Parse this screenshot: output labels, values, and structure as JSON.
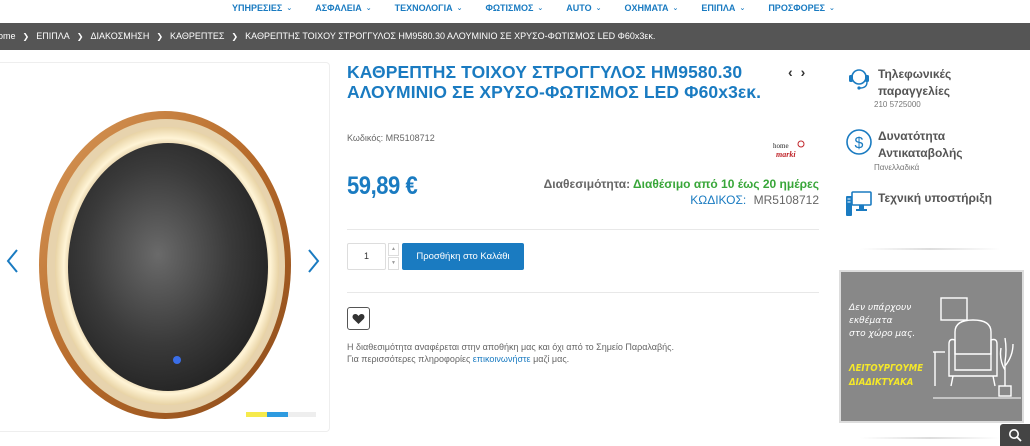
{
  "nav": {
    "items": [
      {
        "label": "ΥΠΗΡΕΣΙΕΣ"
      },
      {
        "label": "ΑΣΦΑΛΕΙΑ"
      },
      {
        "label": "ΤΕΧΝΟΛΟΓΙΑ"
      },
      {
        "label": "ΦΩΤΙΣΜΟΣ"
      },
      {
        "label": "AUTO"
      },
      {
        "label": "ΟΧΗΜΑΤΑ"
      },
      {
        "label": "ΕΠΙΠΛΑ"
      },
      {
        "label": "ΠΡΟΣΦΟΡΕΣ"
      }
    ]
  },
  "breadcrumb": {
    "items": [
      "ome",
      "ΕΠΙΠΛΑ",
      "ΔΙΑΚΟΣΜΗΣΗ",
      "ΚΑΘΡΕΠΤΕΣ",
      "ΚΑΘΡΕΠΤΗΣ ΤΟΙΧΟΥ ΣΤΡΟΓΓΥΛΟΣ ΗΜ9580.30 ΑΛΟΥΜΙΝΙΟ ΣΕ ΧΡΥΣΟ-ΦΩΤΙΣΜΟΣ LED Φ60x3εκ."
    ]
  },
  "product": {
    "title": "ΚΑΘΡΕΠΤΗΣ ΤΟΙΧΟΥ ΣΤΡΟΓΓΥΛΟΣ ΗΜ9580.30 ΑΛΟΥΜΙΝΙΟ ΣΕ ΧΡΥΣΟ-ΦΩΤΙΣΜΟΣ LED Φ60x3εκ.",
    "code_line": "Κωδικός: MR5108712",
    "price": "59,89 €",
    "availability_label": "Διαθεσιμότητα:",
    "availability_value": "Διαθέσιμο από 10 έως 20 ημέρες",
    "code_label": "ΚΩΔΙΚΟΣ:",
    "code_value": "MR5108712",
    "quantity": "1",
    "add_to_cart": "Προσθήκη στο Καλάθι",
    "note_line1": "Η διαθεσιμότητα αναφέρεται στην αποθήκη μας και όχι από το Σημείο Παραλαβής.",
    "note_line2_pre": "Για περισσότερες πληροφορίες ",
    "note_link": "επικοινωνήστε",
    "note_line2_post": " μαζί μας.",
    "brand_text": "home marki"
  },
  "gallery": {
    "progress": 0.6
  },
  "sidebar": {
    "phone_label_1": "Τηλεφωνικές",
    "phone_label_2": "παραγγελίες",
    "phone_number": "210 5725000",
    "cod_label_1": "Δυνατότητα",
    "cod_label_2": "Αντικαταβολής",
    "cod_sub": "Πανελλαδικά",
    "support_label": "Τεχνική υποστήριξη"
  },
  "banner": {
    "line1": "Δεν υπάρχουν",
    "line2": "εκθέματα",
    "line3": "στο χώρο μας.",
    "line4": "ΛΕΙΤΟΥΡΓΟΥΜΕ",
    "line5": "ΔΙΑΔΙΚΤΥΑΚΑ"
  },
  "colors": {
    "accent": "#1a7bc1",
    "available": "#38a639",
    "breadcrumb_bg": "#555555",
    "banner_bg": "#888888",
    "banner_highlight": "#f5e829"
  }
}
